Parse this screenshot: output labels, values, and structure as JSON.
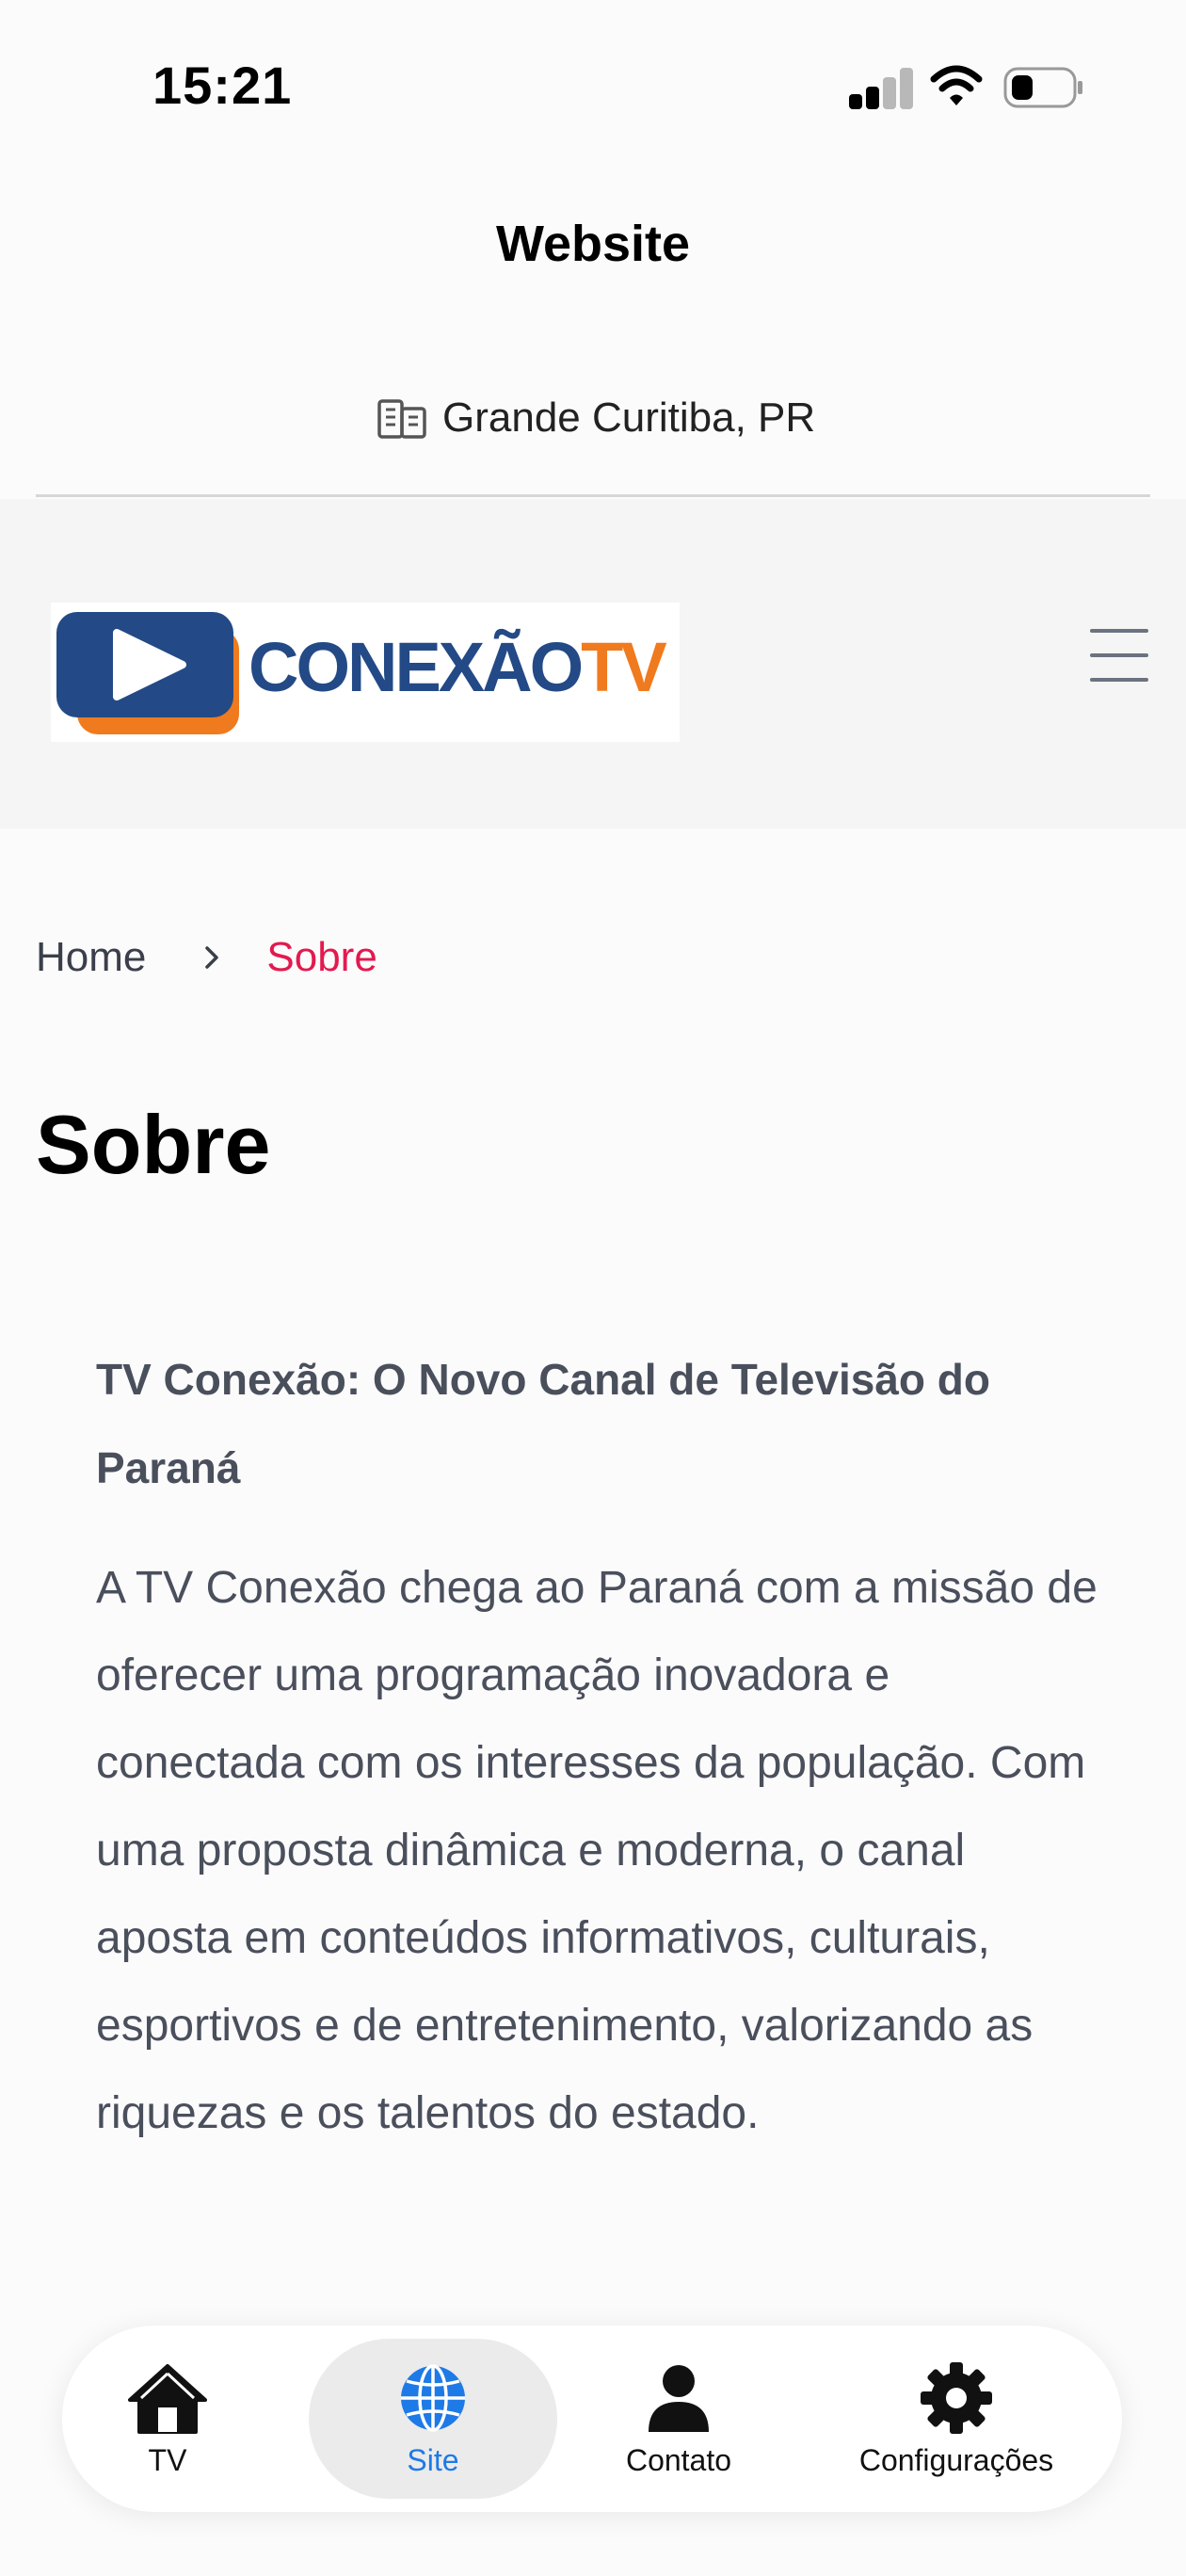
{
  "status_bar": {
    "time": "15:21"
  },
  "nav": {
    "title": "Website"
  },
  "location": {
    "icon": "building-icon",
    "text": "Grande Curitiba, PR"
  },
  "site_header": {
    "logo": {
      "word1": "CONEXÃO",
      "word2": "TV",
      "color_primary": "#234a86",
      "color_accent": "#f07a1e"
    },
    "menu_icon": "hamburger-icon"
  },
  "breadcrumb": {
    "home": "Home",
    "current": "Sobre",
    "current_color": "#e21a4e"
  },
  "page": {
    "title": "Sobre",
    "heading": "TV Conexão: O Novo Canal de Televisão do Paraná",
    "body": "A TV Conexão chega ao Paraná com a missão de oferecer uma programação inovadora e conectada com os interesses da população. Com uma proposta dinâmica e moderna, o canal aposta em conteúdos informativos, culturais, esportivos e de entretenimento, valorizando as riquezas e os talentos do estado."
  },
  "tab_bar": {
    "active_color": "#1e7ae6",
    "tabs": [
      {
        "label": "TV",
        "icon": "house-icon",
        "active": false
      },
      {
        "label": "Site",
        "icon": "globe-icon",
        "active": true
      },
      {
        "label": "Contato",
        "icon": "person-icon",
        "active": false
      },
      {
        "label": "Configurações",
        "icon": "gear-icon",
        "active": false
      }
    ]
  }
}
